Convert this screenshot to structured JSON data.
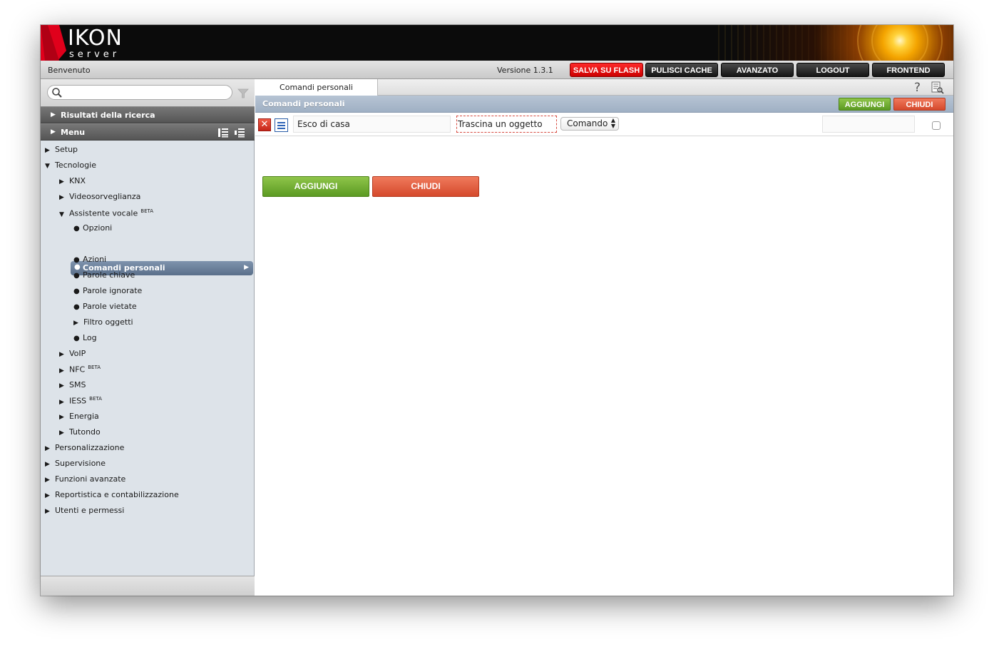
{
  "colors": {
    "header_bg": "#0b0b0b",
    "accent_red": "#e0001b",
    "selected_item": "#6d82a0",
    "green_button": "#6fac30",
    "red_button": "#e05a3c"
  },
  "logo": {
    "line1": "IKON",
    "line2": "server"
  },
  "toolbar": {
    "welcome": "Benvenuto",
    "version": "Versione 1.3.1",
    "save_flash": "SALVA SU FLASH",
    "clear_cache": "PULISCI CACHE",
    "advanced": "AVANZATO",
    "logout": "LOGOUT",
    "frontend": "FRONTEND"
  },
  "sidebar": {
    "search": {
      "placeholder": ""
    },
    "search_results": "Risultati della ricerca",
    "menu_label": "Menu",
    "tree": [
      {
        "label": "Setup"
      },
      {
        "label": "Tecnologie"
      },
      {
        "label": "KNX"
      },
      {
        "label": "Videosorveglianza"
      },
      {
        "label": "Assistente vocale",
        "badge": "BETA"
      },
      {
        "label": "Opzioni"
      },
      {
        "label": "Comandi personali"
      },
      {
        "label": "Azioni"
      },
      {
        "label": "Parole chiave"
      },
      {
        "label": "Parole ignorate"
      },
      {
        "label": "Parole vietate"
      },
      {
        "label": "Filtro oggetti"
      },
      {
        "label": "Log"
      },
      {
        "label": "VoIP"
      },
      {
        "label": "NFC",
        "badge": "BETA"
      },
      {
        "label": "SMS"
      },
      {
        "label": "IESS",
        "badge": "BETA"
      },
      {
        "label": "Energia"
      },
      {
        "label": "Tutondo"
      },
      {
        "label": "Personalizzazione"
      },
      {
        "label": "Supervisione"
      },
      {
        "label": "Funzioni avanzate"
      },
      {
        "label": "Reportistica e contabilizzazione"
      },
      {
        "label": "Utenti e permessi"
      }
    ]
  },
  "main": {
    "tab_label": "Comandi personali",
    "title": "Comandi personali",
    "title_add": "AGGIUNGI",
    "title_close": "CHIUDI",
    "row": {
      "phrase_value": "Esco di casa",
      "drop_text": "Trascina un oggetto",
      "select_value": "Comando",
      "extra_value": ""
    },
    "add_button": "AGGIUNGI",
    "close_button": "CHIUDI"
  }
}
